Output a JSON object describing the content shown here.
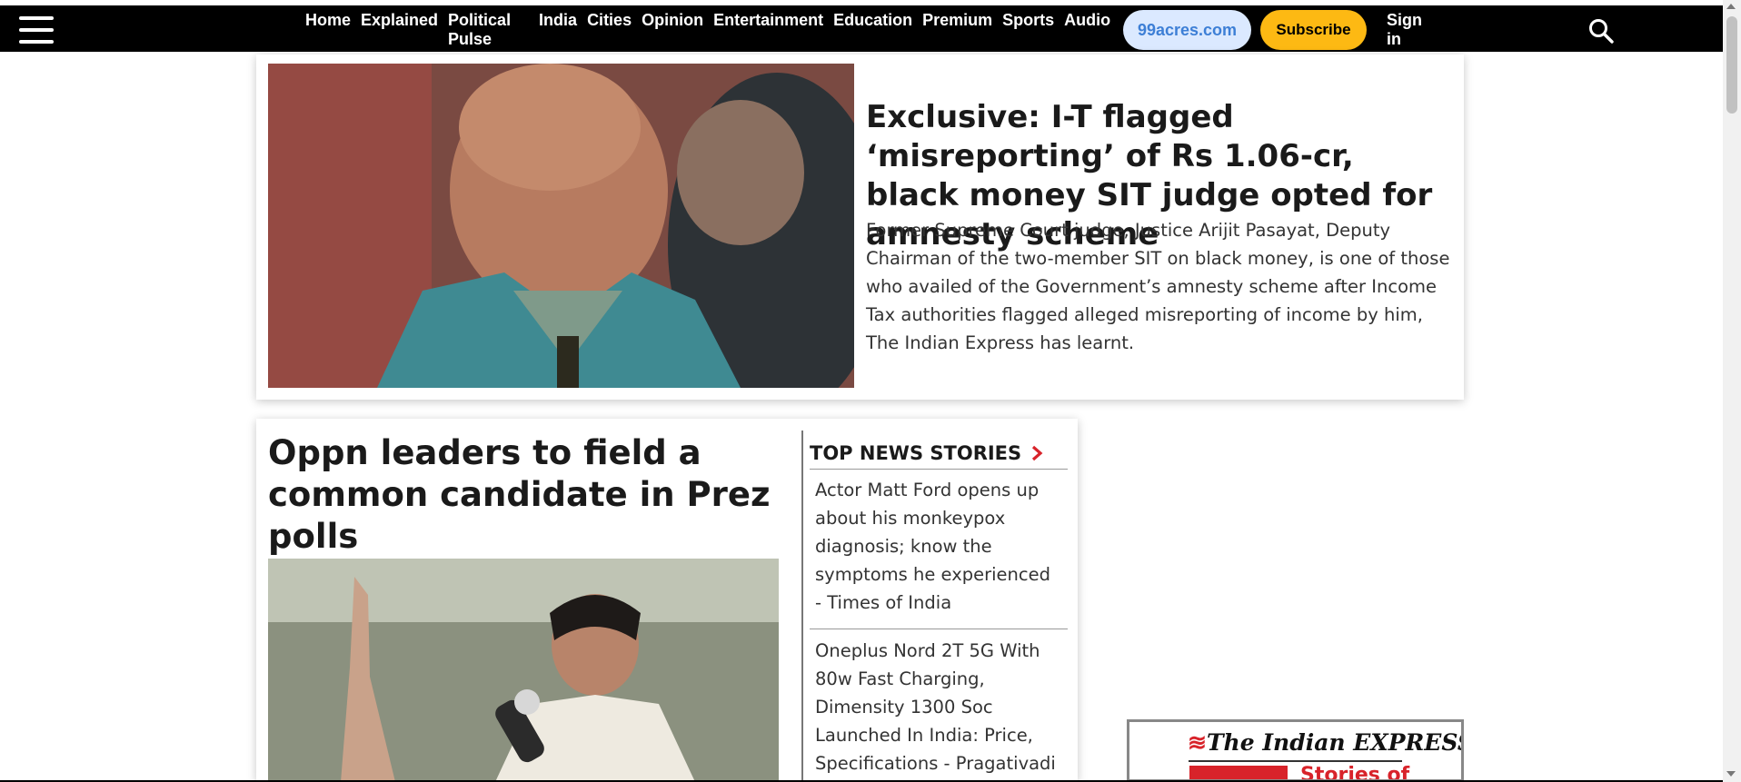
{
  "nav": {
    "items": [
      "Home",
      "Explained",
      "Political Pulse",
      "India",
      "Cities",
      "Opinion",
      "Entertainment",
      "Education",
      "Premium",
      "Sports",
      "Audio"
    ],
    "realestate_button": "99acres.com",
    "subscribe_button": "Subscribe",
    "signin": "Sign in",
    "colors": {
      "bar": "#000000",
      "subscribe": "#fdb913",
      "realestate_bg": "#dbe9ff",
      "realestate_text": "#3d7fd6"
    },
    "icons": [
      "hamburger-menu-icon",
      "search-icon"
    ]
  },
  "hero": {
    "title": "Exclusive: I-T flagged ‘misreporting’ of Rs 1.06-cr, black money SIT judge opted for amnesty scheme",
    "summary": "Former Supreme Court judge, Justice Arijit Pasayat, Deputy Chairman of the two-member SIT on black money, is one of those who availed of the Government’s amnesty scheme after Income Tax authorities flagged alleged misreporting of income by him, The Indian Express has learnt."
  },
  "lead": {
    "title": "Oppn leaders to field a common candidate in Prez polls"
  },
  "top_news": {
    "heading": "TOP NEWS STORIES",
    "items": [
      "Actor Matt Ford opens up about his monkeypox diagnosis; know the symptoms he experienced - Times of India",
      "Oneplus Nord 2T 5G With 80w Fast Charging, Dimensity 1300 Soc Launched In India: Price, Specifications - Pragativadi"
    ]
  },
  "ad": {
    "brand": "The Indian EXPRESS",
    "accent": "#d8232a"
  }
}
